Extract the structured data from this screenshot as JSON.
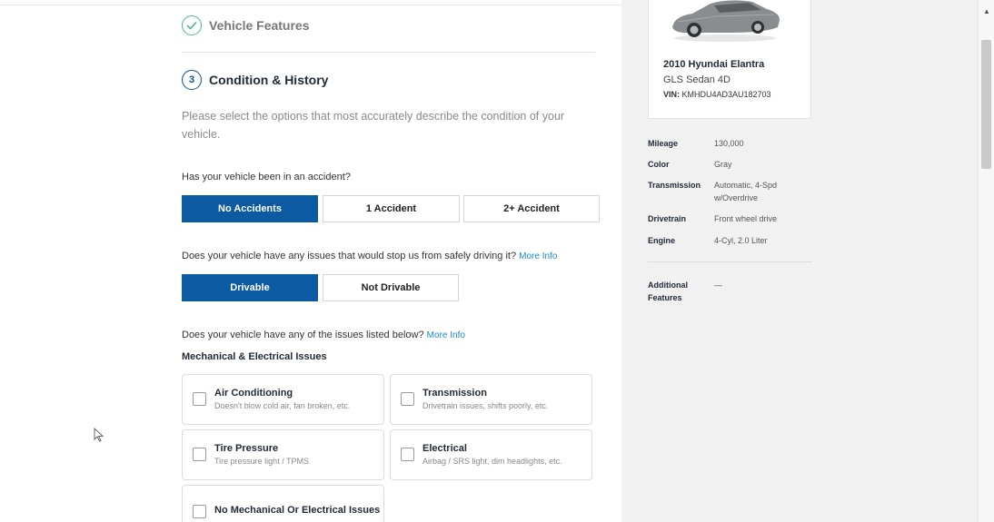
{
  "steps": {
    "vehicle_features": "Vehicle Features",
    "condition_number": "3",
    "condition_title": "Condition & History"
  },
  "intro": "Please select the options that most accurately describe the condition of your vehicle.",
  "accident": {
    "question": "Has your vehicle been in an accident?",
    "options": [
      "No Accidents",
      "1 Accident",
      "2+ Accident"
    ],
    "selected": "No Accidents"
  },
  "drivable": {
    "question": "Does your vehicle have any issues that would stop us from safely driving it?",
    "more_info": "More Info",
    "options": [
      "Drivable",
      "Not Drivable"
    ],
    "selected": "Drivable"
  },
  "issues": {
    "question": "Does your vehicle have any of the issues listed below?",
    "more_info": "More Info",
    "subheading": "Mechanical & Electrical Issues",
    "options": [
      {
        "title": "Air Conditioning",
        "desc": "Doesn't blow cold air, fan broken, etc."
      },
      {
        "title": "Transmission",
        "desc": "Drivetrain issues, shifts poorly, etc."
      },
      {
        "title": "Tire Pressure",
        "desc": "Tire pressure light / TPMS"
      },
      {
        "title": "Electrical",
        "desc": "Airbag / SRS light, dim headlights, etc."
      },
      {
        "title": "No Mechanical Or Electrical Issues",
        "desc": ""
      }
    ]
  },
  "vehicle": {
    "name": "2010 Hyundai Elantra",
    "trim": "GLS Sedan 4D",
    "vin_label": "VIN:",
    "vin": "KMHDU4AD3AU182703",
    "specs": [
      {
        "label": "Mileage",
        "value": "130,000"
      },
      {
        "label": "Color",
        "value": "Gray"
      },
      {
        "label": "Transmission",
        "value": "Automatic, 4-Spd w/Overdrive"
      },
      {
        "label": "Drivetrain",
        "value": "Front wheel drive"
      },
      {
        "label": "Engine",
        "value": "4-Cyl, 2.0 Liter"
      }
    ],
    "additional_label": "Additional Features",
    "additional_value": "—"
  },
  "colors": {
    "primary": "#0b5aa2",
    "success": "#4cb58b",
    "link": "#1a8ac6",
    "sidebar_bg": "#f1f1f1"
  }
}
